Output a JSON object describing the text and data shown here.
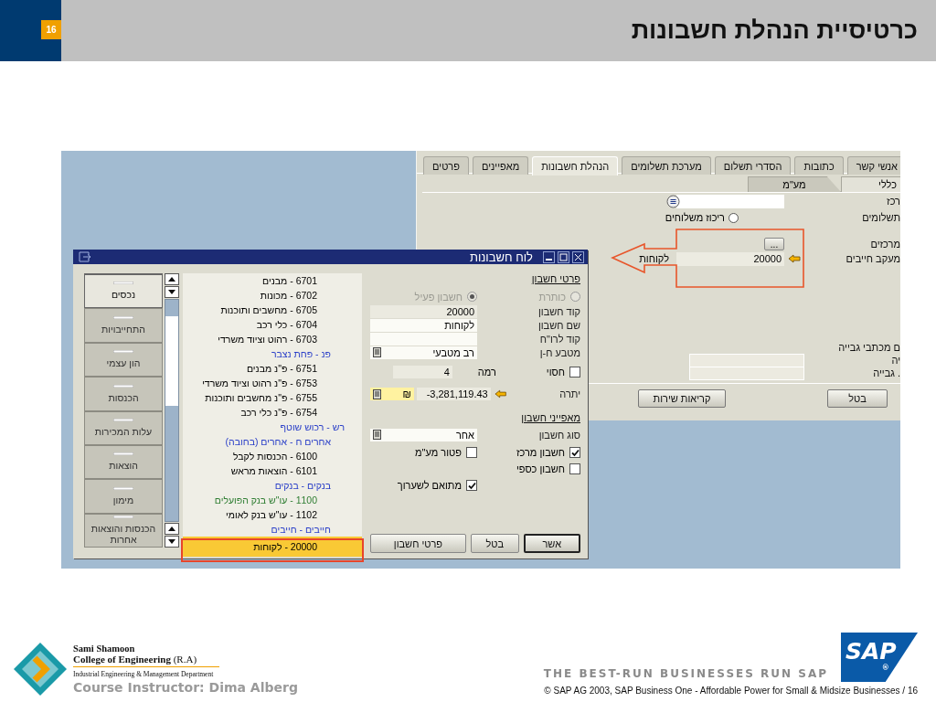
{
  "slide": {
    "title": "כרטיסיית הנהלת חשבונות",
    "page_number": "16"
  },
  "screenshot": {
    "bp_window": {
      "tabs": [
        {
          "label": "אנשי קשר",
          "selected": false
        },
        {
          "label": "כתובות",
          "selected": false
        },
        {
          "label": "הסדרי תשלום",
          "selected": false
        },
        {
          "label": "מערכת תשלומים",
          "selected": false
        },
        {
          "label": "הנהלת חשבונות",
          "selected": true
        },
        {
          "label": "מאפיינים",
          "selected": false
        },
        {
          "label": "פרטים",
          "selected": false
        }
      ],
      "subtabs": [
        {
          "label": "כללי",
          "selected": true
        },
        {
          "label": "מע\"מ",
          "selected": false
        }
      ],
      "rows": [
        {
          "kind": "select",
          "label": "רכז"
        },
        {
          "kind": "radio",
          "label": "תשלומים",
          "option": "ריכוז משלוחים",
          "selected": false
        },
        {
          "kind": "button",
          "label": "מרכזים",
          "button": "..."
        },
        {
          "kind": "account",
          "label": "מעקב חייבים",
          "value": "20000",
          "name": "לקוחות"
        }
      ],
      "lower_rows": [
        {
          "kind": "text",
          "label": "ם מכתבי גבייה"
        },
        {
          "kind": "input",
          "label": "יה"
        },
        {
          "kind": "input",
          "label": ". גבייה"
        }
      ],
      "buttons": [
        {
          "label": "בטל"
        },
        {
          "label": "קריאות שירות"
        }
      ]
    },
    "dialog": {
      "title": "לוח חשבונות",
      "drawers": [
        {
          "label": "נכסים",
          "selected": true
        },
        {
          "label": "התחייבויות",
          "selected": false
        },
        {
          "label": "הון עצמי",
          "selected": false
        },
        {
          "label": "הכנסות",
          "selected": false
        },
        {
          "label": "עלות המכירות",
          "selected": false
        },
        {
          "label": "הוצאות",
          "selected": false
        },
        {
          "label": "מימון",
          "selected": false
        },
        {
          "label": "הכנסות והוצאות אחרות",
          "selected": false
        }
      ],
      "accounts": [
        {
          "kind": "account",
          "label": "6701 - מבנים",
          "color": "#000000",
          "selected": false
        },
        {
          "kind": "account",
          "label": "6702 - מכונות",
          "color": "#000000",
          "selected": false
        },
        {
          "kind": "account",
          "label": "6705 - מחשבים ותוכנות",
          "color": "#000000",
          "selected": false
        },
        {
          "kind": "account",
          "label": "6704 - כלי רכב",
          "color": "#000000",
          "selected": false
        },
        {
          "kind": "account",
          "label": "6703 - רהוט וציוד משרדי",
          "color": "#000000",
          "selected": false
        },
        {
          "kind": "title",
          "label": "פנ - פחת נצבר",
          "color": "#2a3fc8",
          "selected": false,
          "children": [
            {
              "kind": "account",
              "label": "6751 - פ\"נ מבנים",
              "color": "#000000",
              "selected": false
            },
            {
              "kind": "account",
              "label": "6753 - פ\"נ רהוט וציוד משרדי",
              "color": "#000000",
              "selected": false
            },
            {
              "kind": "account",
              "label": "6755 - פ\"נ מחשבים ותוכנות",
              "color": "#000000",
              "selected": false
            },
            {
              "kind": "account",
              "label": "6754 - פ\"נ כלי רכב",
              "color": "#000000",
              "selected": false
            }
          ]
        },
        {
          "kind": "group",
          "label": "רש - רכוש שוטף",
          "color": "#2a3fc8",
          "selected": false,
          "children": [
            {
              "kind": "title",
              "label": "אחרים ח - אחרים (בחובה)",
              "color": "#2a3fc8",
              "selected": false,
              "children": [
                {
                  "kind": "account",
                  "label": "6100 - הכנסות לקבל",
                  "color": "#000000",
                  "selected": false
                },
                {
                  "kind": "account",
                  "label": "6101 - הוצאות מראש",
                  "color": "#000000",
                  "selected": false
                }
              ]
            },
            {
              "kind": "title",
              "label": "בנקים - בנקים",
              "color": "#2a3fc8",
              "selected": false,
              "children": [
                {
                  "kind": "account",
                  "label": "1100 - עו\"ש בנק הפועלים",
                  "color": "#2e7d32",
                  "selected": false
                },
                {
                  "kind": "account",
                  "label": "1102 - עו\"ש בנק לאומי",
                  "color": "#000000",
                  "selected": false
                }
              ]
            },
            {
              "kind": "title",
              "label": "חייבים - חייבים",
              "color": "#2a3fc8",
              "selected": false,
              "children": [
                {
                  "kind": "account",
                  "label": "20000 - לקוחות",
                  "selected": true
                }
              ]
            }
          ]
        }
      ],
      "details": {
        "header": "פרטי חשבון",
        "radios": [
          {
            "label": "כותרת",
            "selected": false,
            "disabled": true
          },
          {
            "label": "חשבון פעיל",
            "selected": true,
            "disabled": true
          }
        ],
        "fields": [
          {
            "kind": "readonly",
            "label": "קוד חשבון",
            "value": "20000"
          },
          {
            "kind": "text",
            "label": "שם חשבון",
            "value": "לקוחות"
          },
          {
            "kind": "text",
            "label": "קוד לרו\"ח"
          },
          {
            "kind": "dropdown",
            "label": "מטבע ח-ן",
            "value": "רב מטבעי"
          }
        ],
        "confidential": {
          "label": "חסוי",
          "checked": false
        },
        "level_field": {
          "label": "רמה",
          "value": "4"
        },
        "balance": {
          "label": "יתרה",
          "value": "-3,281,119.43",
          "currency": "₪"
        },
        "properties_header": "מאפייני חשבון",
        "account_type": {
          "label": "סוג חשבון",
          "value": "אחר"
        },
        "options": {
          "column_1": [
            {
              "label": "חשבון מרכז",
              "checked": true
            },
            {
              "label": "חשבון כספי",
              "checked": false
            }
          ],
          "column_2": [
            {
              "label": "פטור מע\"מ",
              "checked": false
            },
            {
              "label": "מתואם לשערוך",
              "checked": true
            }
          ]
        }
      },
      "buttons": [
        {
          "label": "אשר",
          "default": true
        },
        {
          "label": "בטל",
          "default": false
        },
        {
          "label": "פרטי חשבון",
          "default": false
        }
      ]
    }
  },
  "footer": {
    "institution": "Sami Shamoon",
    "college": "**College of Engineering** (R.A)",
    "department": "Industrial Engineering & Management Department",
    "instructor": "Course Instructor: Dima Alberg",
    "tagline": "THE BEST-RUN BUSINESSES RUN SAP",
    "logo_text": "SAP",
    "logo_mark": "®",
    "copyright": "© SAP AG 2003, SAP Business One - Affordable Power for Small & Midsize Businesses / 16"
  }
}
